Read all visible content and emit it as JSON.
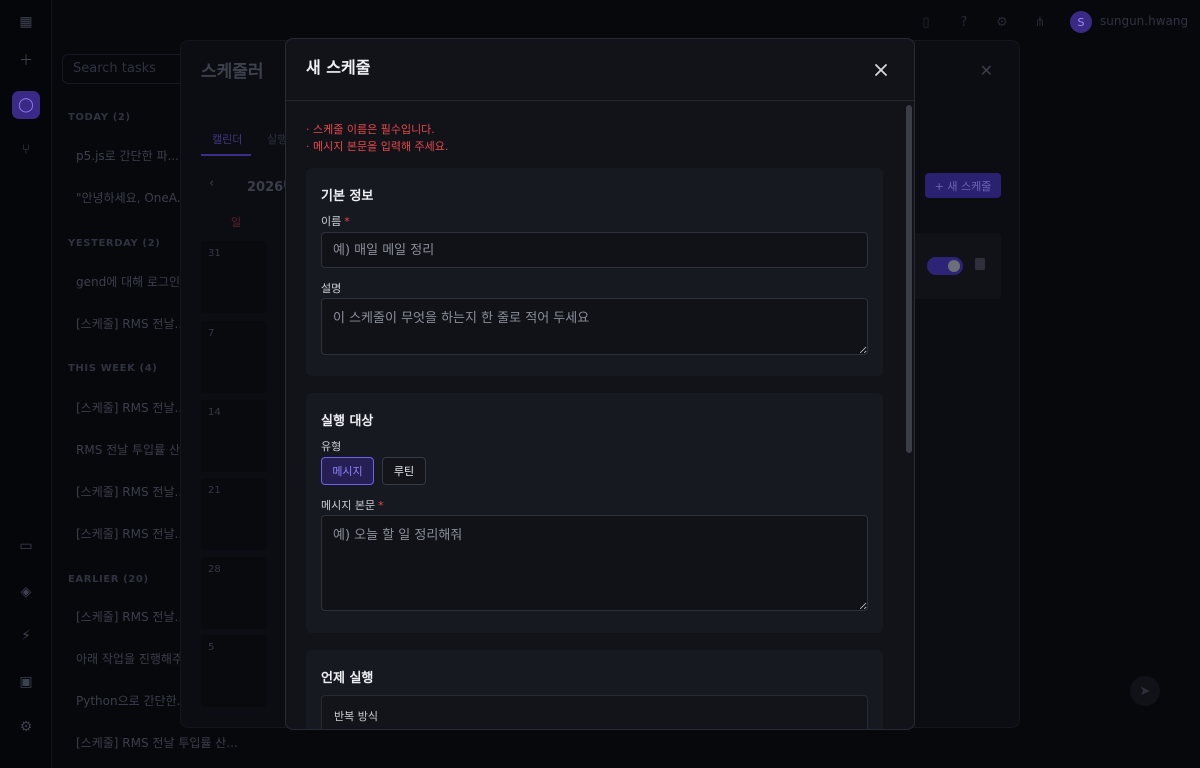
{
  "background": {
    "search_placeholder": "Search tasks",
    "groups": [
      {
        "label": "TODAY (2)",
        "chats": [
          "p5.js로 간단한 파...",
          "\"안녕하세요, OneA..."
        ]
      },
      {
        "label": "YESTERDAY (2)",
        "chats": [
          "gend에 대해 로그인...",
          "[스케줄] RMS 전날..."
        ]
      },
      {
        "label": "THIS WEEK (4)",
        "chats": [
          "[스케줄] RMS 전날...",
          "RMS 전날 투입률 산...",
          "[스케줄] RMS 전날...",
          "[스케줄] RMS 전날..."
        ]
      },
      {
        "label": "EARLIER (20)",
        "chats": [
          "[스케줄] RMS 전날...",
          "아래 작업을 진행해주...",
          "Python으로 간단한...",
          "[스케줄] RMS 전날 투입률 산..."
        ]
      }
    ],
    "username": "sungun.hwang",
    "avatar_letter": "S",
    "scheduler": {
      "title": "스케줄러",
      "tabs": [
        "캘린더",
        "실행"
      ],
      "month": "2026년",
      "day_label": "일",
      "day_numbers": [
        "31",
        "7",
        "14",
        "21",
        "28",
        "5"
      ],
      "new_button": "+ 새 스케줄"
    }
  },
  "modal": {
    "title": "새 스케줄",
    "errors": [
      "· 스케줄 이름은 필수입니다.",
      "· 메시지 본문을 입력해 주세요."
    ],
    "basic": {
      "title": "기본 정보",
      "name_label": "이름",
      "required_mark": "*",
      "name_placeholder": "예) 매일 메일 정리",
      "desc_label": "설명",
      "desc_placeholder": "이 스케줄이 무엇을 하는지 한 줄로 적어 두세요"
    },
    "target": {
      "title": "실행 대상",
      "type_label": "유형",
      "types": [
        "메시지",
        "루틴"
      ],
      "selected_type": "메시지",
      "body_label": "메시지 본문",
      "required_mark": "*",
      "body_placeholder": "예) 오늘 할 일 정리해줘"
    },
    "when": {
      "title": "언제 실행",
      "repeat_label": "반복 방식"
    }
  },
  "colors": {
    "accent": "#6d5ff0",
    "error": "#e5484d",
    "modal_bg": "#111319",
    "section_bg": "#171920"
  }
}
